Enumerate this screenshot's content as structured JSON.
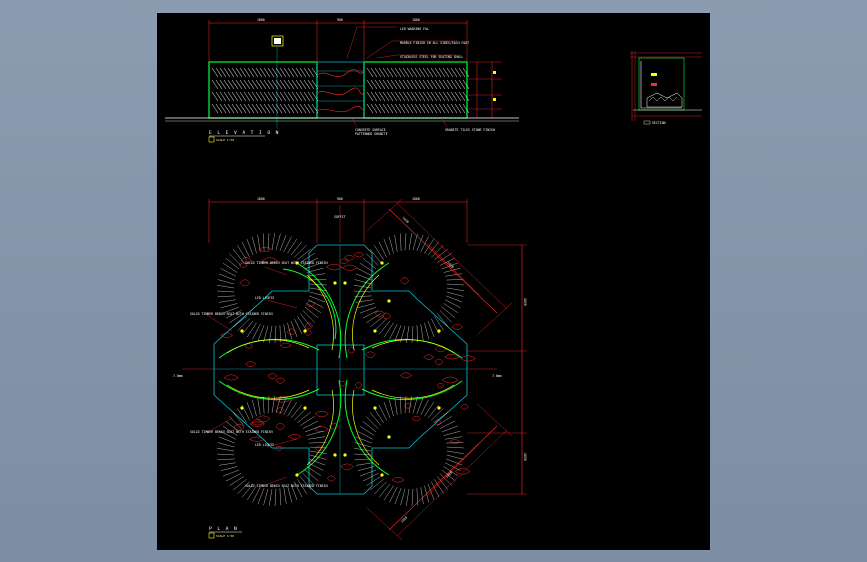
{
  "sheet": {
    "background": "#000000",
    "viewer_background": "#8b9bb0"
  },
  "colors": {
    "dimension": "#ff2a2a",
    "outline": "#00ff30",
    "grid": "#00c8d8",
    "seating": "#ffffff",
    "yellow": "#ffff00",
    "text": "#ffffff"
  },
  "elevation": {
    "title": "E L E V A T I O N",
    "scale": "SCALE 1:50",
    "dims": [
      "1800",
      "900",
      "1800"
    ],
    "callouts": [
      "LED WASHING FAL",
      "MARBLE FINISH IN ALL SIDES/EACH FOOT",
      "STAINLESS STEEL FOR SEATING SHELL"
    ],
    "notes_bottom": [
      "CONCRETE SURFACE",
      "PATTERNED GRANITE",
      "GRANITE TILES STONE FINISH"
    ]
  },
  "plan": {
    "title": "P L A N",
    "scale": "SCALE 1:50",
    "dims_top": [
      "1800",
      "900",
      "1800"
    ],
    "dim_mid": "SOFFIT",
    "side_labels": [
      "7.0mm",
      "7.0mm"
    ],
    "notes": [
      "SOLID TIMBER BENCH SEAT WITH STAINED FINISH",
      "LED LIGHTS",
      "SOLID TIMBER BENCH SEAT WITH STAINED FINISH",
      "SOLID TIMBER BENCH SEAT WITH STAINED FINISH",
      "LED LIGHTS",
      "SOLID TIMBER BENCH SEAT WITH STAINED FINISH"
    ],
    "diag_dims": [
      "1420",
      "1420",
      "1420",
      "1420"
    ],
    "right_dims": [
      "1850",
      "1850"
    ]
  },
  "section": {
    "title": "SECTION"
  }
}
